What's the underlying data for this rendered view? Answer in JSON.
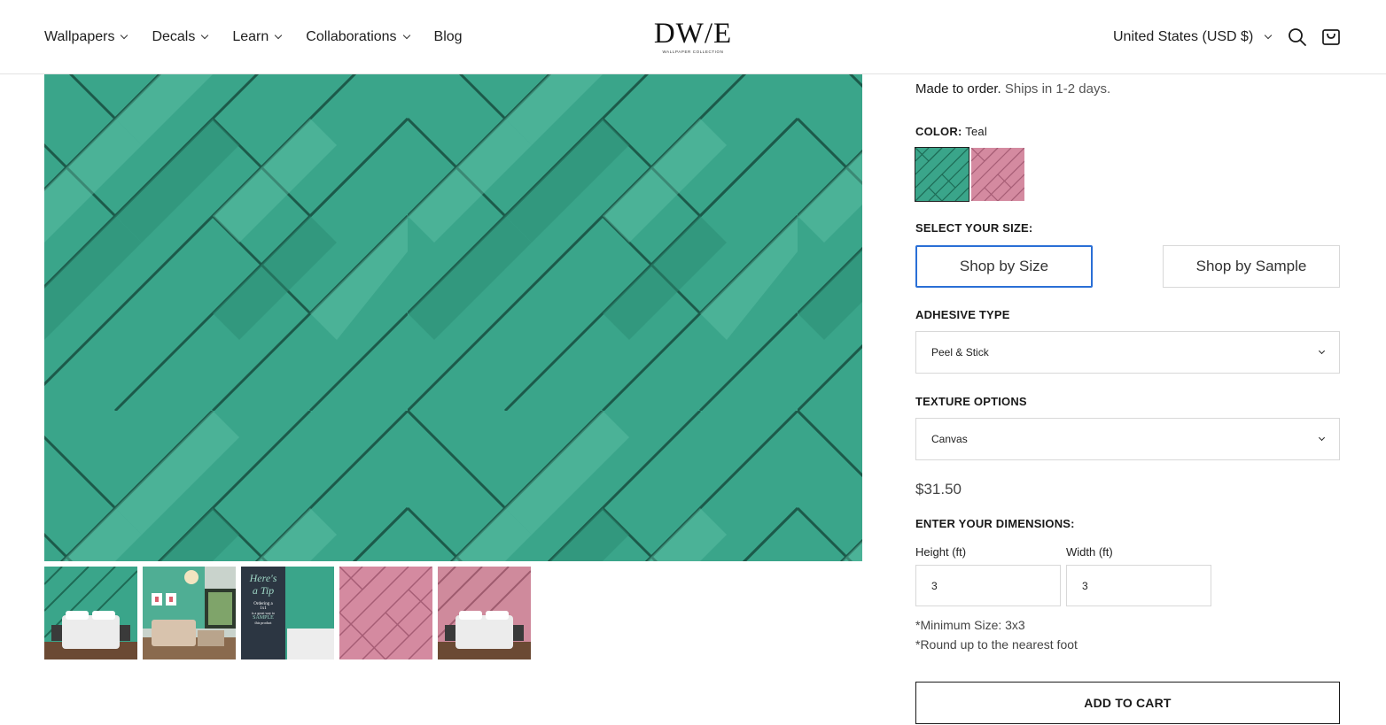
{
  "nav": {
    "items": [
      {
        "label": "Wallpapers",
        "has_dropdown": true
      },
      {
        "label": "Decals",
        "has_dropdown": true
      },
      {
        "label": "Learn",
        "has_dropdown": true
      },
      {
        "label": "Collaborations",
        "has_dropdown": true
      },
      {
        "label": "Blog",
        "has_dropdown": false
      }
    ]
  },
  "logo": {
    "main": "DW/E",
    "sub": "WALLPAPER COLLECTION"
  },
  "header": {
    "region": "United States (USD $)",
    "search_icon": "search-icon",
    "cart_icon": "shopping-bag-icon"
  },
  "gallery": {
    "main_color": "#3aa58a",
    "thumbnails": [
      {
        "name": "teal-bedroom"
      },
      {
        "name": "teal-living-room"
      },
      {
        "name": "tip-card",
        "text_lines": [
          "Here's",
          "a Tip",
          "Ordering a",
          "1x1",
          "is a great way to",
          "SAMPLE",
          "this product"
        ]
      },
      {
        "name": "pink-pattern"
      },
      {
        "name": "pink-bedroom"
      }
    ]
  },
  "product": {
    "ship_bold": "Made to order.",
    "ship_rest": " Ships in 1-2 days.",
    "color_label": "COLOR:",
    "color_value": "Teal",
    "swatches": [
      {
        "name": "Teal",
        "hex": "#3aa58a",
        "selected": true
      },
      {
        "name": "Pink",
        "hex": "#d48aa0",
        "selected": false
      }
    ],
    "size_label": "SELECT YOUR SIZE:",
    "size_options": [
      "Shop by Size",
      "Shop by Sample"
    ],
    "adhesive_label": "ADHESIVE TYPE",
    "adhesive_value": "Peel & Stick",
    "texture_label": "TEXTURE OPTIONS",
    "texture_value": "Canvas",
    "price": "$31.50",
    "dimensions_label": "ENTER YOUR DIMENSIONS:",
    "height_label": "Height (ft)",
    "height_value": "3",
    "width_label": "Width (ft)",
    "width_value": "3",
    "note_min": "*Minimum Size: 3x3",
    "note_round": "*Round up to the nearest foot",
    "cart_label": "ADD TO CART",
    "accent": "#2a6fd6"
  }
}
